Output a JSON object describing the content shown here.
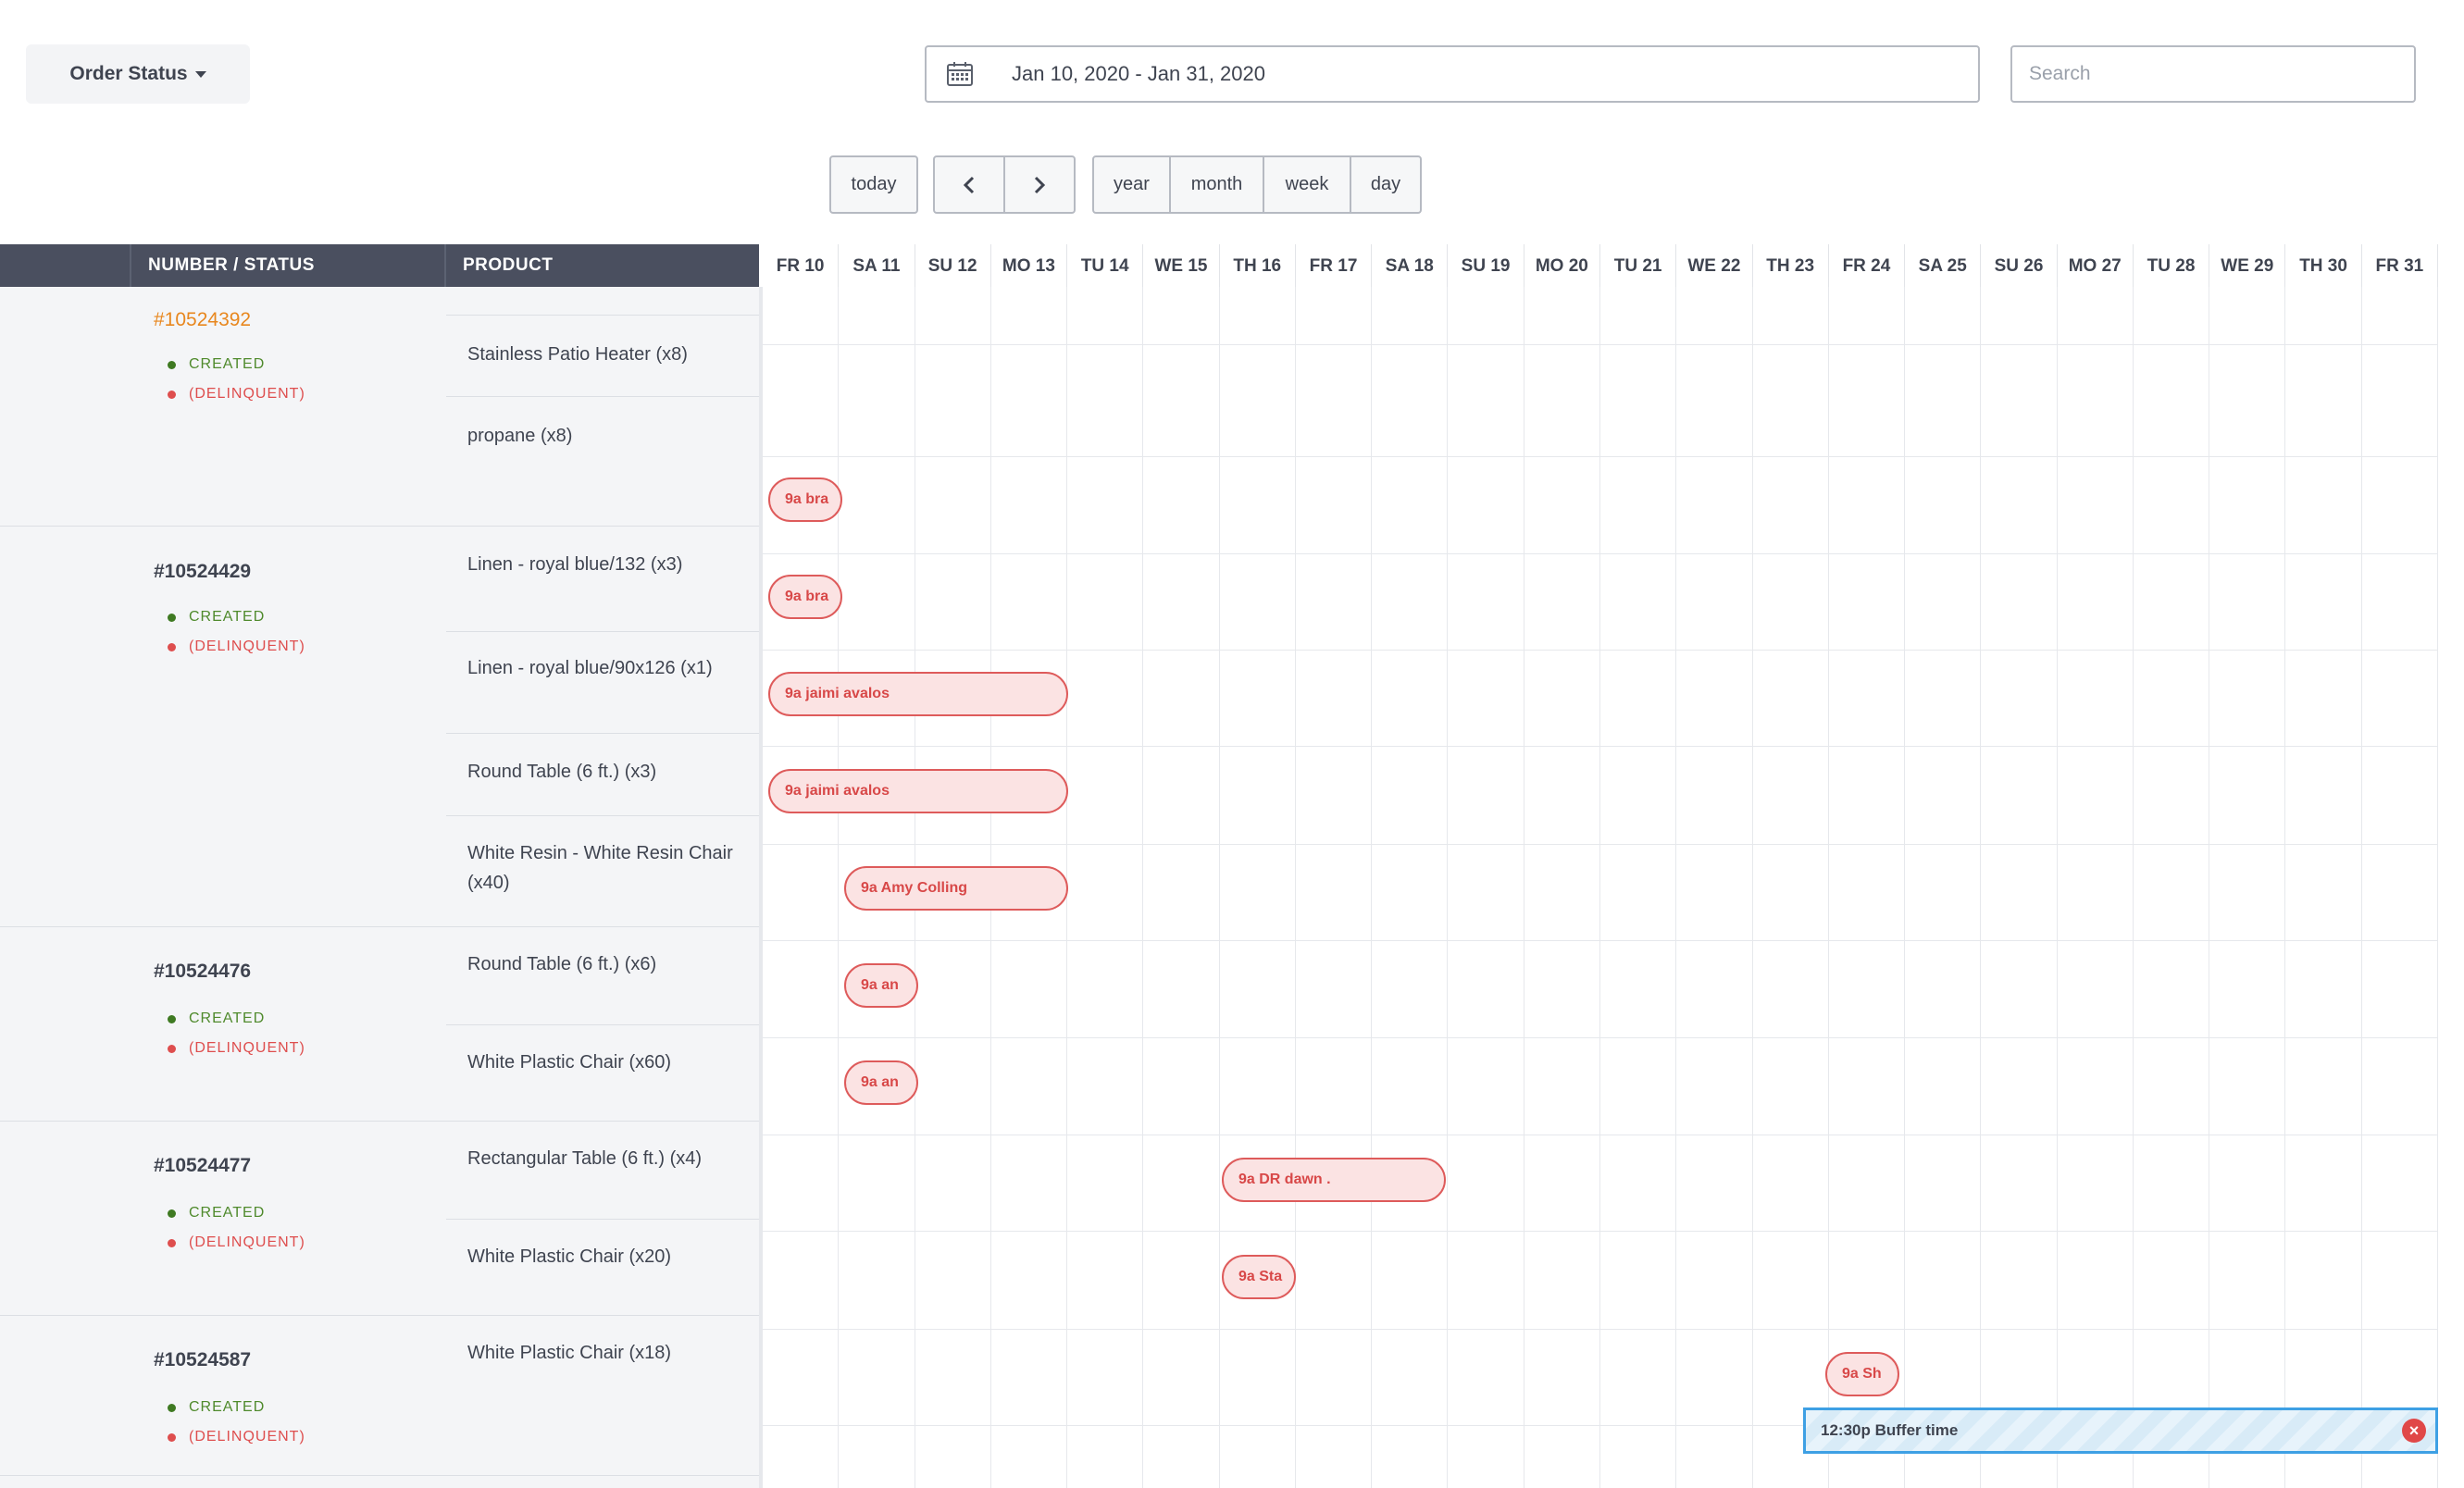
{
  "toolbar": {
    "order_status_label": "Order Status",
    "date_range": "Jan 10, 2020 - Jan 31, 2020",
    "search_placeholder": "Search"
  },
  "nav": {
    "today": "today",
    "prev": "‹",
    "next": "›",
    "views": [
      "year",
      "month",
      "week",
      "day"
    ]
  },
  "columns": {
    "number_status": "NUMBER / STATUS",
    "product": "PRODUCT"
  },
  "days": [
    "FR 10",
    "SA 11",
    "SU 12",
    "MO 13",
    "TU 14",
    "WE 15",
    "TH 16",
    "FR 17",
    "SA 18",
    "SU 19",
    "MO 20",
    "TU 21",
    "WE 22",
    "TH 23",
    "FR 24",
    "SA 25",
    "SU 26",
    "MO 27",
    "TU 28",
    "WE 29",
    "TH 30",
    "FR 31"
  ],
  "orders": [
    {
      "number": "#10524392",
      "statuses": [
        "CREATED",
        "(DELINQUENT)"
      ],
      "products": [
        "Stainless Patio Heater (x8)",
        "propane (x8)"
      ]
    },
    {
      "number": "#10524429",
      "statuses": [
        "CREATED",
        "(DELINQUENT)"
      ],
      "products": [
        "Linen - royal blue/132 (x3)",
        "Linen - royal blue/90x126 (x1)",
        "Round Table (6 ft.) (x3)",
        "White Resin - White Resin Chair (x40)"
      ]
    },
    {
      "number": "#10524476",
      "statuses": [
        "CREATED",
        "(DELINQUENT)"
      ],
      "products": [
        "Round Table (6 ft.) (x6)",
        "White Plastic Chair (x60)"
      ]
    },
    {
      "number": "#10524477",
      "statuses": [
        "CREATED",
        "(DELINQUENT)"
      ],
      "products": [
        "Rectangular Table (6 ft.) (x4)",
        "White Plastic Chair (x20)"
      ]
    },
    {
      "number": "#10524587",
      "statuses": [
        "CREATED",
        "(DELINQUENT)"
      ],
      "products": [
        "White Plastic Chair (x18)"
      ]
    }
  ],
  "events": [
    {
      "label": "9a bra"
    },
    {
      "label": "9a bra"
    },
    {
      "label": "9a jaimi avalos"
    },
    {
      "label": "9a jaimi avalos"
    },
    {
      "label": "9a Amy Colling"
    },
    {
      "label": "9a an"
    },
    {
      "label": "9a an"
    },
    {
      "label": "9a DR dawn ."
    },
    {
      "label": "9a Sta"
    },
    {
      "label": "9a Sh"
    }
  ],
  "buffer": {
    "label": "12:30p Buffer time",
    "close": "×"
  },
  "colors": {
    "event_fill": "#fbe3e3",
    "event_border": "#de5b5b",
    "created": "#4f8a2c",
    "delinquent": "#de4e4e",
    "link": "#e8871e",
    "header_bg": "#4a4f5f",
    "buffer_border": "#3ea0e4"
  }
}
